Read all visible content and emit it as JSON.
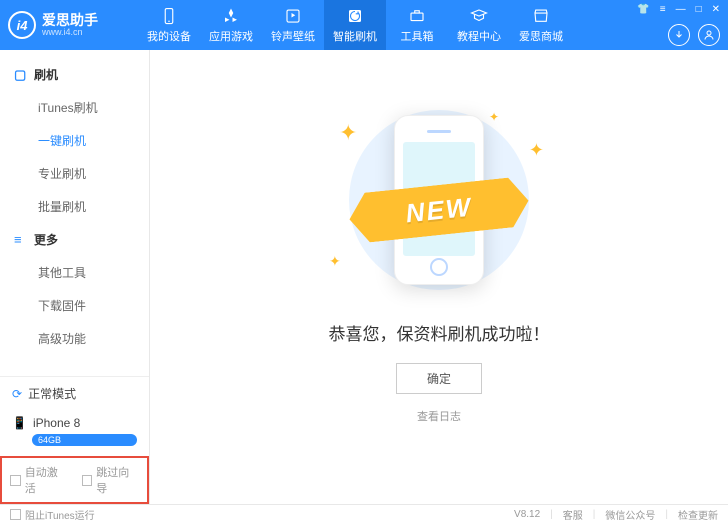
{
  "app": {
    "name": "爱思助手",
    "url": "www.i4.cn",
    "logo_text": "i4"
  },
  "nav": [
    {
      "label": "我的设备",
      "icon": "device"
    },
    {
      "label": "应用游戏",
      "icon": "apps"
    },
    {
      "label": "铃声壁纸",
      "icon": "media"
    },
    {
      "label": "智能刷机",
      "icon": "flash",
      "active": true
    },
    {
      "label": "工具箱",
      "icon": "tools"
    },
    {
      "label": "教程中心",
      "icon": "tutorial"
    },
    {
      "label": "爱思商城",
      "icon": "store"
    }
  ],
  "sidebar": {
    "groups": [
      {
        "title": "刷机",
        "icon": "phone",
        "items": [
          {
            "label": "iTunes刷机"
          },
          {
            "label": "一键刷机",
            "active": true
          },
          {
            "label": "专业刷机"
          },
          {
            "label": "批量刷机"
          }
        ]
      },
      {
        "title": "更多",
        "icon": "more",
        "items": [
          {
            "label": "其他工具"
          },
          {
            "label": "下载固件"
          },
          {
            "label": "高级功能"
          }
        ]
      }
    ]
  },
  "status": {
    "mode": "正常模式",
    "device": "iPhone 8",
    "storage": "64GB"
  },
  "checkboxes": {
    "auto_activate": "自动激活",
    "skip_guide": "跳过向导"
  },
  "content": {
    "ribbon": "NEW",
    "success": "恭喜您，保资料刷机成功啦！",
    "ok": "确定",
    "view_log": "查看日志"
  },
  "footer": {
    "block_itunes": "阻止iTunes运行",
    "version": "V8.12",
    "support": "客服",
    "wechat": "微信公众号",
    "update": "检查更新"
  }
}
